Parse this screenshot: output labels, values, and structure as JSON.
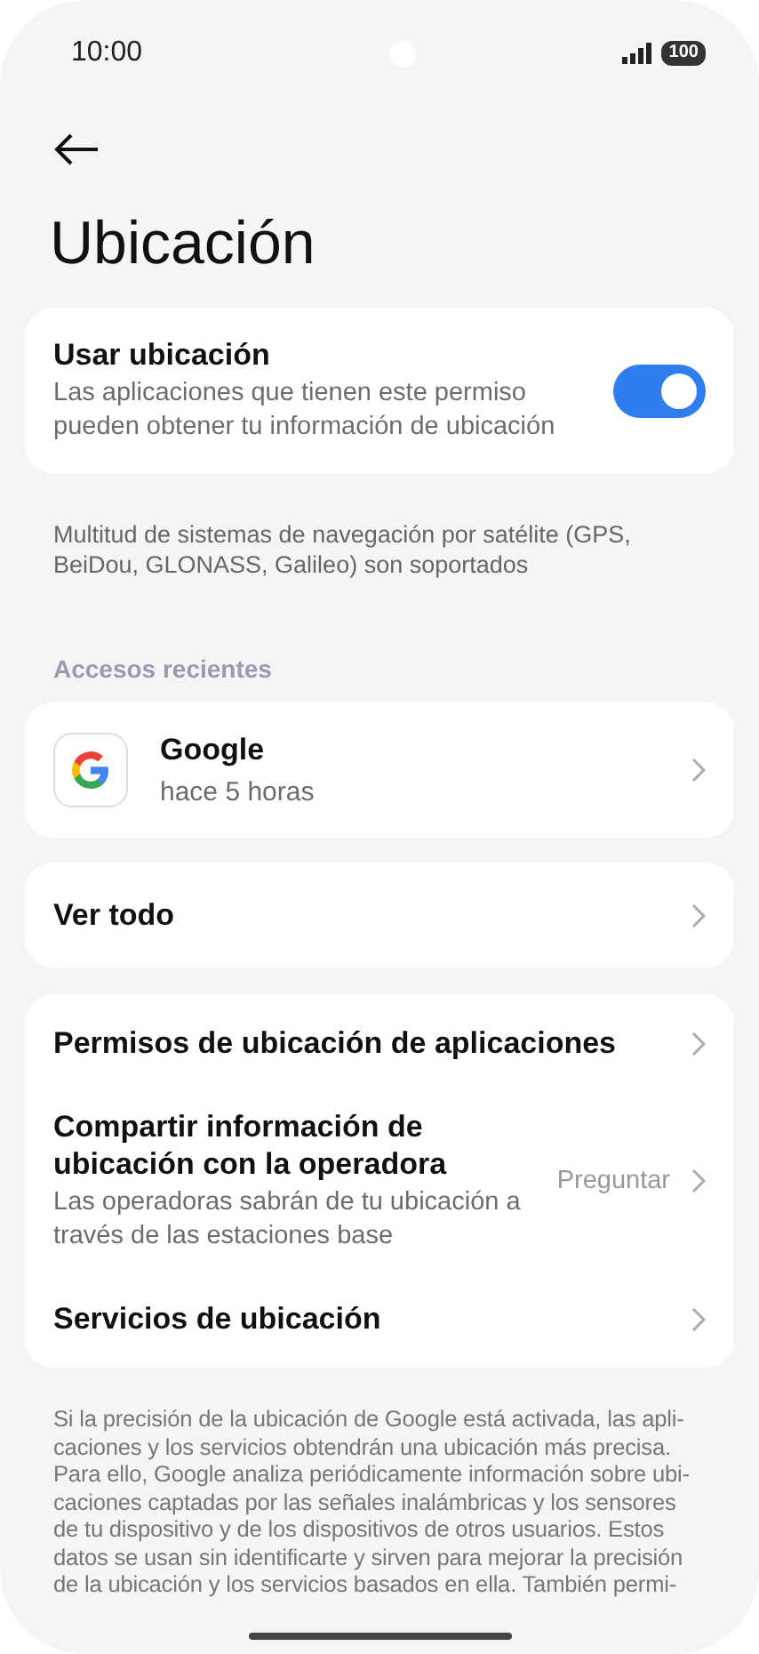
{
  "status_bar": {
    "time": "10:00",
    "battery": "100"
  },
  "title": "Ubicación",
  "use_location": {
    "label": "Usar ubicación",
    "description": "Las aplicaciones que tienen este permiso pueden obtener tu información de ubicación",
    "on": true
  },
  "note": "Multitud de sistemas de navegación por satélite (GPS, BeiDou, GLONASS, Galileo) son soportados",
  "recent": {
    "heading": "Accesos recientes",
    "apps": [
      {
        "name": "Google",
        "time": "hace 5 horas"
      }
    ]
  },
  "see_all": "Ver todo",
  "settings": [
    {
      "label": "Permisos de ubicación de aplicaciones"
    },
    {
      "label": "Compartir información de ubicación con la operadora",
      "description": "Las operadoras sabrán de tu ubicación a través de las estaciones base",
      "value": "Preguntar"
    },
    {
      "label": "Servicios de ubicación"
    }
  ],
  "footer": "Si la precisión de la ubicación de Google está activada, las apli-\ncaciones y los servicios obtendrán una ubicación más precisa.\nPara ello, Google analiza periódicamente información sobre ubi-\ncaciones captadas por las señales inalámbricas y los sensores\nde tu dispositivo y de los dispositivos de otros usuarios. Estos\ndatos se usan sin identificarte y sirven para mejorar la precisión\nde la ubicación y los servicios basados en ella. También permi-"
}
